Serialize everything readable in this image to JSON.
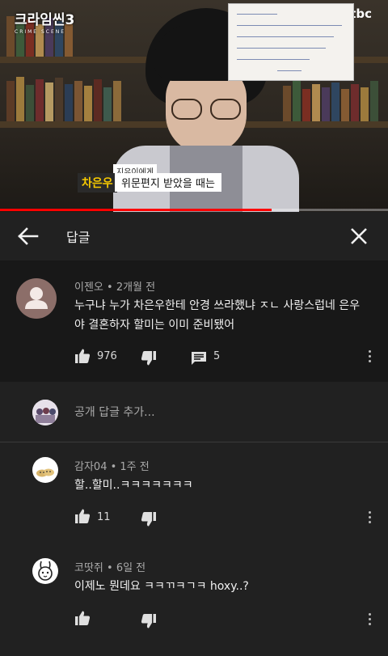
{
  "video": {
    "show_logo": "크라임씬3",
    "show_logo_sub": "CRIME SCENE",
    "channel_logo": "jtbc",
    "caption_small": "지유이에게",
    "caption_name": "차은우",
    "caption_text": "위문편지 받았을 때는",
    "progress_percent": 70
  },
  "header": {
    "back_icon": "arrow-left-icon",
    "title": "답글",
    "close_icon": "close-icon"
  },
  "parent_comment": {
    "author": "이젠오",
    "time": "2개월 전",
    "meta": "이젠오 • 2개월 전",
    "text_line1": "누구냐 누가 차은우한테 안경 쓰라했냐 ㅈㄴ 사랑스럽네 은우",
    "text_line2": "야 결혼하자 할미는 이미 준비됐어",
    "likes": "976",
    "replies": "5"
  },
  "add_reply": {
    "placeholder": "공개 답글 추가..."
  },
  "replies": [
    {
      "meta": "감자04 • 1주 전",
      "text": "할..할미..ㅋㅋㅋㅋㅋㅋㅋ",
      "likes": "11"
    },
    {
      "meta": "코땃쥐 • 6일 전",
      "text": "이제노 뭔데요 ㅋㅋㄲㅋㄱㅋ hoxy..?",
      "likes": ""
    }
  ],
  "colors": {
    "background": "#212121",
    "parent_background": "#181818",
    "progress": "#ff0000",
    "meta_text": "#aaaaaa"
  }
}
